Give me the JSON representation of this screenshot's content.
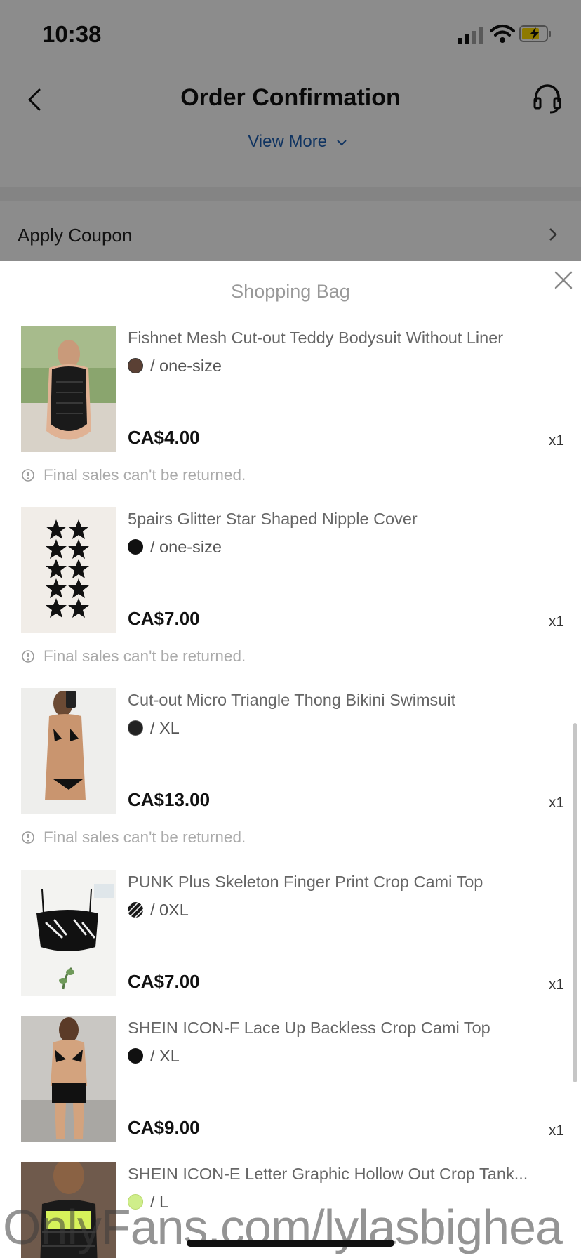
{
  "status_bar": {
    "time": "10:38"
  },
  "header": {
    "title": "Order Confirmation",
    "view_more": "View More"
  },
  "coupon": {
    "label": "Apply Coupon"
  },
  "sheet": {
    "title": "Shopping Bag",
    "items": [
      {
        "name": "Fishnet Mesh Cut-out Teddy Bodysuit Without Liner",
        "variant": "/ one-size",
        "swatch": "#5a4034",
        "price": "CA$4.00",
        "qty": "x1",
        "note": "Final sales can't be returned."
      },
      {
        "name": "5pairs Glitter Star Shaped Nipple Cover",
        "variant": "/ one-size",
        "swatch": "#111111",
        "price": "CA$7.00",
        "qty": "x1",
        "note": "Final sales can't be returned."
      },
      {
        "name": "Cut-out Micro Triangle Thong Bikini Swimsuit",
        "variant": "/ XL",
        "swatch": "#222222",
        "price": "CA$13.00",
        "qty": "x1",
        "note": "Final sales can't be returned."
      },
      {
        "name": "PUNK Plus Skeleton Finger Print Crop Cami Top",
        "variant": "/ 0XL",
        "swatch": "#1a1a1a",
        "price": "CA$7.00",
        "qty": "x1"
      },
      {
        "name": "SHEIN ICON-F Lace Up Backless Crop Cami Top",
        "variant": "/ XL",
        "swatch": "#111111",
        "price": "CA$9.00",
        "qty": "x1"
      },
      {
        "name": "SHEIN ICON-E Letter Graphic Hollow Out Crop Tank...",
        "variant": "/ L",
        "swatch": "#cfee8a"
      }
    ]
  },
  "watermark": "OnlyFans.com/lylasbighea",
  "colors": {
    "link_blue": "#1d5aa8",
    "overlay": "rgba(0,0,0,0.42)"
  }
}
